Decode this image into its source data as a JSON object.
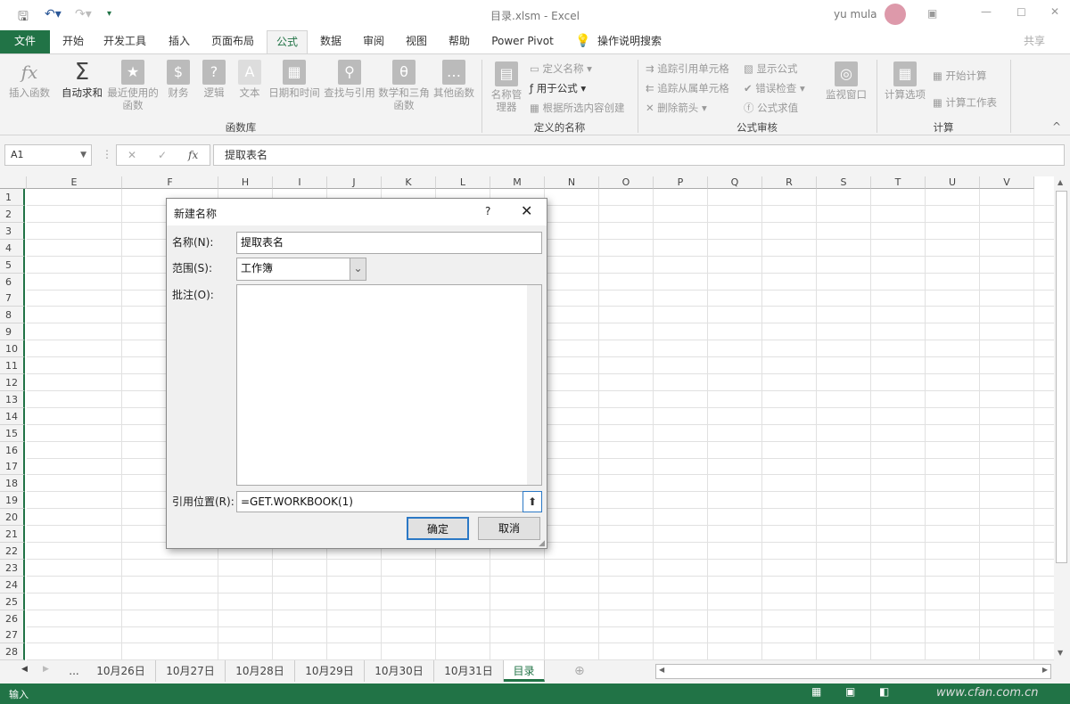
{
  "titlebar": {
    "title": "目录.xlsm  -  Excel",
    "user": "yu mula",
    "share": "共享"
  },
  "tabs": [
    "文件",
    "开始",
    "开发工具",
    "插入",
    "页面布局",
    "公式",
    "数据",
    "审阅",
    "视图",
    "帮助",
    "Power Pivot"
  ],
  "tell_me": "操作说明搜索",
  "ribbon": {
    "function_library": {
      "label": "函数库",
      "buttons": [
        "插入函数",
        "自动求和",
        "最近使用的函数",
        "财务",
        "逻辑",
        "文本",
        "日期和时间",
        "查找与引用",
        "数学和三角函数",
        "其他函数"
      ]
    },
    "defined_names": {
      "label": "定义的名称",
      "name_manager": "名称管理器",
      "items": [
        "定义名称",
        "用于公式",
        "根据所选内容创建"
      ]
    },
    "formula_auditing": {
      "label": "公式审核",
      "items": [
        "追踪引用单元格",
        "追踪从属单元格",
        "删除箭头",
        "显示公式",
        "错误检查",
        "公式求值"
      ],
      "watch": "监视窗口"
    },
    "calculation": {
      "label": "计算",
      "options": "计算选项",
      "items": [
        "开始计算",
        "计算工作表"
      ]
    }
  },
  "formula_bar": {
    "name_box": "A1",
    "content": "提取表名"
  },
  "columns": [
    "E",
    "F",
    "H",
    "I",
    "J",
    "K",
    "L",
    "M",
    "N",
    "O",
    "P",
    "Q",
    "R",
    "S",
    "T",
    "U",
    "V"
  ],
  "rows": [
    "1",
    "2",
    "3",
    "4",
    "5",
    "6",
    "7",
    "8",
    "9",
    "10",
    "11",
    "12",
    "13",
    "14",
    "15",
    "16",
    "17",
    "18",
    "19",
    "20",
    "21",
    "22",
    "23",
    "24",
    "25",
    "26",
    "27",
    "28"
  ],
  "dialog": {
    "title": "新建名称",
    "help": "?",
    "name_label": "名称(N):",
    "name_value": "提取表名",
    "scope_label": "范围(S):",
    "scope_value": "工作簿",
    "comment_label": "批注(O):",
    "refers_label": "引用位置(R):",
    "refers_value": "=GET.WORKBOOK(1)",
    "ok": "确定",
    "cancel": "取消"
  },
  "sheet_tabs": {
    "ellipsis": "...",
    "tabs": [
      "10月26日",
      "10月27日",
      "10月28日",
      "10月29日",
      "10月30日",
      "10月31日",
      "目录"
    ],
    "active": "目录"
  },
  "status": {
    "mode": "输入",
    "watermark": "www.cfan.com.cn"
  },
  "colors": {
    "accent": "#217346"
  }
}
